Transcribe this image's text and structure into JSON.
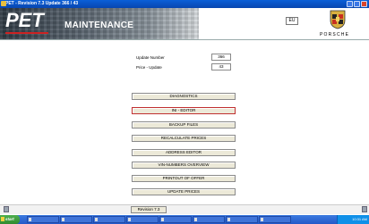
{
  "window": {
    "title": "PET - Revision 7.3 Update 366 / 43"
  },
  "header": {
    "logo": "PET",
    "title": "MAINTENANCE",
    "language": "EU",
    "brand": "PORSCHE"
  },
  "fields": {
    "update_number_label": "Update Number",
    "update_number_value": "366",
    "price_update_label": "Price - Update",
    "price_update_value": "43"
  },
  "buttons": [
    "DIAGNOSTICS",
    "INI - EDITOR",
    "BACKUP FILES",
    "RECALCULATE PRICES",
    "ADDRESS EDITOR",
    "VIN-NUMBERS OVERVIEW",
    "PRINTOUT OF OFFER",
    "UPDATE PRICES"
  ],
  "footer": {
    "revision": "Revision 7.3"
  },
  "taskbar": {
    "start": "start",
    "items": [
      "",
      "",
      "",
      "",
      "",
      "",
      "",
      ""
    ],
    "clock": "10:31 AM"
  }
}
